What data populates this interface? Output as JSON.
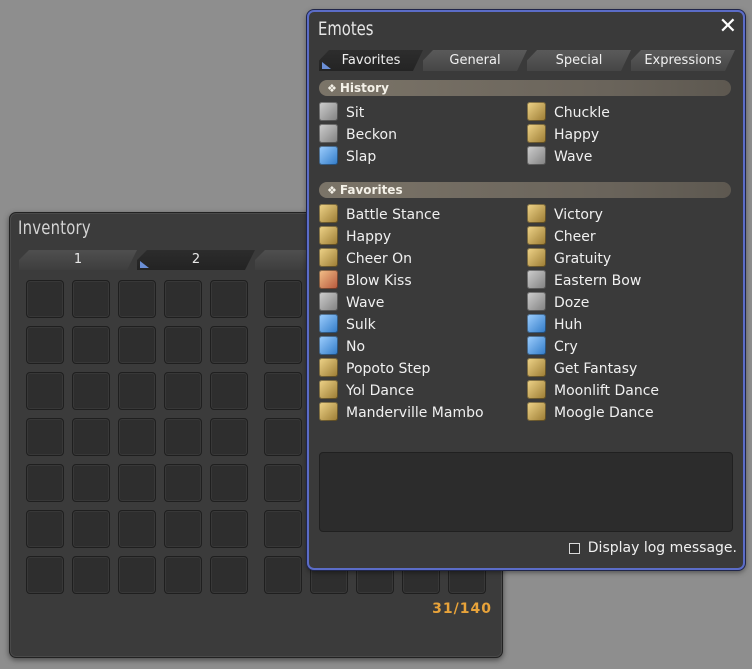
{
  "inventory": {
    "title": "Inventory",
    "tabs": [
      "1",
      "2"
    ],
    "active_tab": 1,
    "count": "31/140"
  },
  "emotes": {
    "title": "Emotes",
    "close": "✕",
    "tabs": [
      "Favorites",
      "General",
      "Special",
      "Expressions"
    ],
    "active_tab": 0,
    "history_label": "History",
    "favorites_label": "Favorites",
    "history": [
      {
        "label": "Sit",
        "icon": "gray"
      },
      {
        "label": "Chuckle",
        "icon": "gold"
      },
      {
        "label": "Beckon",
        "icon": "gray"
      },
      {
        "label": "Happy",
        "icon": "gold"
      },
      {
        "label": "Slap",
        "icon": "blue"
      },
      {
        "label": "Wave",
        "icon": "gray"
      }
    ],
    "favorites": [
      {
        "label": "Battle Stance",
        "icon": "gold"
      },
      {
        "label": "Victory",
        "icon": "gold"
      },
      {
        "label": "Happy",
        "icon": "gold"
      },
      {
        "label": "Cheer",
        "icon": "gold"
      },
      {
        "label": "Cheer On",
        "icon": "gold"
      },
      {
        "label": "Gratuity",
        "icon": "gold"
      },
      {
        "label": "Blow Kiss",
        "icon": "red"
      },
      {
        "label": "Eastern Bow",
        "icon": "gray"
      },
      {
        "label": "Wave",
        "icon": "gray"
      },
      {
        "label": "Doze",
        "icon": "gray"
      },
      {
        "label": "Sulk",
        "icon": "blue"
      },
      {
        "label": "Huh",
        "icon": "blue"
      },
      {
        "label": "No",
        "icon": "blue"
      },
      {
        "label": "Cry",
        "icon": "blue"
      },
      {
        "label": "Popoto Step",
        "icon": "gold"
      },
      {
        "label": "Get Fantasy",
        "icon": "gold"
      },
      {
        "label": "Yol Dance",
        "icon": "gold"
      },
      {
        "label": "Moonlift Dance",
        "icon": "gold"
      },
      {
        "label": "Manderville Mambo",
        "icon": "gold"
      },
      {
        "label": "Moogle Dance",
        "icon": "gold"
      }
    ],
    "log_label": "Display log message.",
    "log_checked": false
  }
}
